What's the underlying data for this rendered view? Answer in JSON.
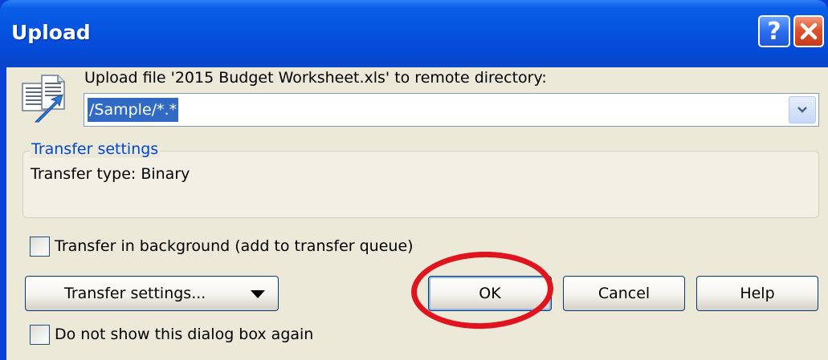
{
  "window": {
    "title": "Upload",
    "help_icon": "question-mark-icon",
    "close_icon": "close-icon"
  },
  "main": {
    "icon": "upload-file-icon",
    "prompt": "Upload file '2015 Budget Worksheet.xls' to remote directory:",
    "directory_value": "/Sample/*.*",
    "dropdown_icon": "chevron-down-icon"
  },
  "group": {
    "label": "Transfer settings",
    "transfer_type": "Transfer type: Binary"
  },
  "options": {
    "background_label": "Transfer in background (add to transfer queue)",
    "background_checked": false,
    "dont_show_label": "Do not show this dialog box again",
    "dont_show_checked": false
  },
  "buttons": {
    "transfer_settings": "Transfer settings...",
    "ok": "OK",
    "cancel": "Cancel",
    "help": "Help"
  },
  "annotation": {
    "color": "#e0141e",
    "target": "OK"
  },
  "colors": {
    "titlebar": "#0553e0",
    "dialog_bg": "#ece9d8",
    "selection": "#316ac5",
    "group_label": "#0046d5"
  }
}
